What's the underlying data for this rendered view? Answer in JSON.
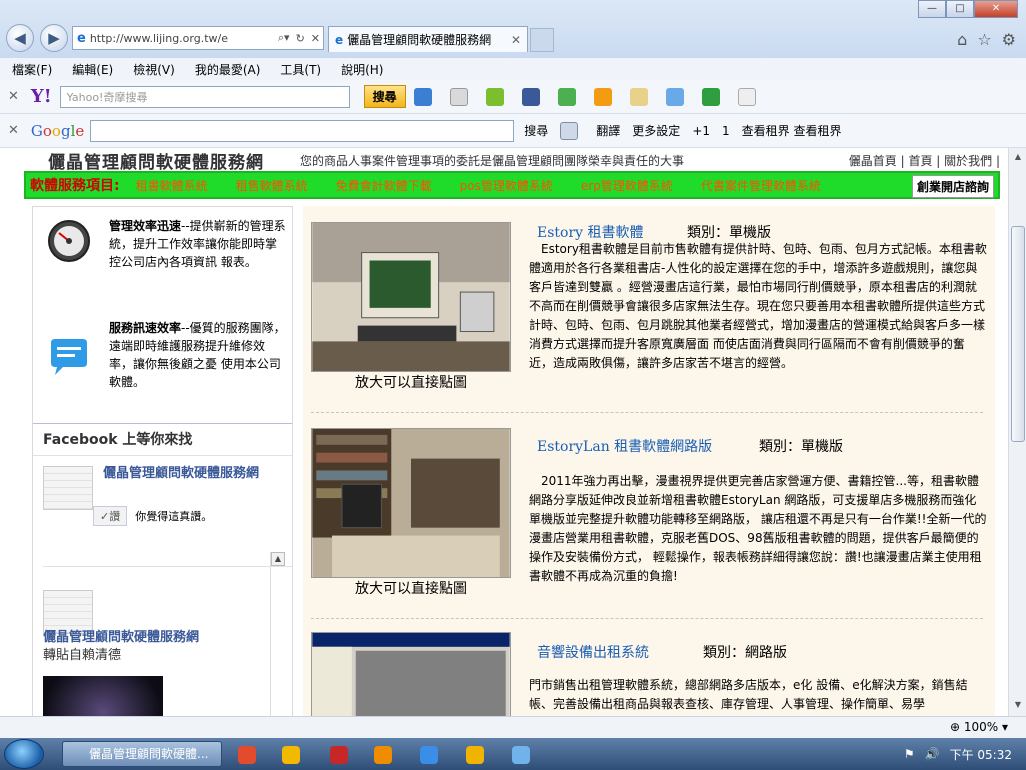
{
  "browser": {
    "url": "http://www.lijing.org.tw/e",
    "tab_title": "儷晶管理顧問軟硬體服務網",
    "win_min": "—",
    "win_max": "□",
    "win_close": "✕"
  },
  "menu": [
    "檔案(F)",
    "編輯(E)",
    "檢視(V)",
    "我的最愛(A)",
    "工具(T)",
    "說明(H)"
  ],
  "yahoo_bar": {
    "logo": "Y!",
    "placeholder": "Yahoo!奇摩搜尋",
    "search_label": "搜尋"
  },
  "google_bar": {
    "logo": "Google",
    "search_label": "搜尋",
    "translate_label": "翻譯",
    "settings_label": "更多設定",
    "plus_label": "+1",
    "count_label": "1",
    "extra_label": "查看租界 查看租界"
  },
  "site": {
    "title": "儷晶管理顧問軟硬體服務網",
    "slogan": "您的商品人事案件管理事項的委託是儷晶管理顧問團隊榮幸與責任的大事",
    "links": "儷晶首頁 | 首頁 | 關於我們 |",
    "nav_title": "軟體服務項目:",
    "nav_items": [
      "租書軟體系統",
      "租售軟體系統",
      "免費會計軟體下載",
      "pos管理軟體系統",
      "erp管理軟體系統",
      "代書案件管理軟體系統"
    ],
    "nav_cta": "創業開店諮詢"
  },
  "features": [
    {
      "title": "管理效率迅速",
      "text": "--提供嶄新的管理系統，提升工作效率讓你能即時掌控公司店內各項資訊 報表。"
    },
    {
      "title": "服務訊速效率",
      "text": "--優質的服務團隊，遠端即時維護服務提升維修效率，讓你無後顧之憂 使用本公司軟體。"
    }
  ],
  "facebook": {
    "header": "Facebook 上等你來找",
    "page_name": "儷晶管理顧問軟硬體服務網",
    "like_label": "✓讚",
    "like_text": "你覺得這真讚。",
    "post_name": "儷晶管理顧問軟硬體服務網",
    "post_text": "轉貼自賴清德"
  },
  "products": [
    {
      "name": "Estory 租書軟體",
      "category": "類別：單機版",
      "caption": "放大可以直接點圖",
      "desc": "Estory租書軟體是目前市售軟體有提供計時、包時、包雨、包月方式記帳。本租書軟體適用於各行各業租書店-人性化的設定選擇在您的手中，增添許多遊戲規則，讓您與客戶皆達到雙贏 。經營漫畫店這行業，最怕市場同行削價競爭，原本租書店的利潤就不高而在削價競爭會讓很多店家無法生存。現在您只要善用本租書軟體所提供這些方式計時、包時、包雨、包月跳脫其他業者經營式，增加漫畫店的營運模式給與客戶多一樣消費方式選擇而提升客原寬廣層面 而使店面消費與同行區隔而不會有削價競爭的奮近，造成兩敗俱傷，讓許多店家苦不堪言的經營。"
    },
    {
      "name": "EstoryLan 租書軟體網路版",
      "category": "類別：單機版",
      "caption": "放大可以直接點圖",
      "desc": "2011年強力再出擊，漫畫視界提供更完善店家營運方便、書籍控管...等，租書軟體網路分享版延伸改良並新增租書軟體EstoryLan 網路版，可支援單店多機服務而強化單機版並完整提升軟體功能轉移至網路版， 讓店租還不再是只有一台作業!!全新一代的漫畫店營業用租書軟體，克服老舊DOS、98舊版租書軟體的問題，提供客戶最簡便的操作及安裝備份方式， 輕鬆操作，報表帳務詳細得讓您說：讚!也讓漫畫店業主使用租書軟體不再成為沉重的負擔!"
    },
    {
      "name": "音響設備出租系統",
      "category": "類別：網路版",
      "caption": "",
      "desc": "門市銷售出租管理軟體系統，總部網路多店版本，e化 設備、e化解決方案，銷售結帳、完善設備出租商品與報表查核、庫存管理、人事管理、操作簡單、易學"
    }
  ],
  "status": {
    "zoom": "100%"
  },
  "taskbar": {
    "item": "儷晶管理顧問軟硬體...",
    "clock": "下午 05:32"
  }
}
